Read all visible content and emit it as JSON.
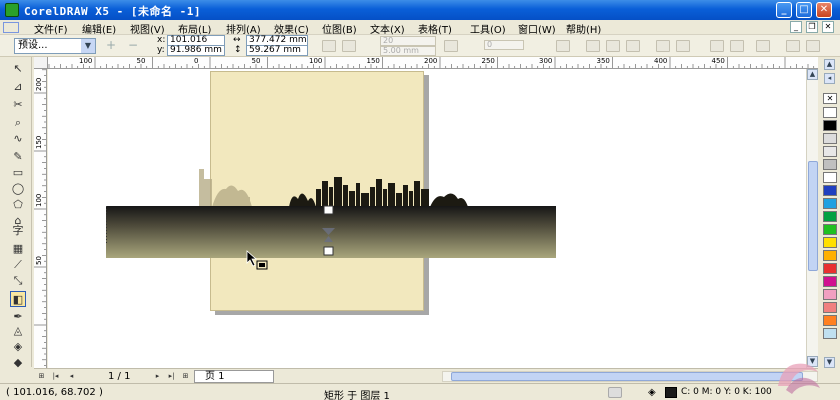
{
  "window": {
    "title": "CorelDRAW X5 - [未命名 -1]",
    "minimize_glyph": "_",
    "maximize_glyph": "□",
    "close_glyph": "✕"
  },
  "menu": {
    "items": [
      "文件(F)",
      "编辑(E)",
      "视图(V)",
      "布局(L)",
      "排列(A)",
      "效果(C)",
      "位图(B)",
      "文本(X)",
      "表格(T)",
      "工具(O)",
      "窗口(W)",
      "帮助(H)"
    ]
  },
  "propbar": {
    "preset_value": "预设...",
    "add_glyph": "+",
    "remove_glyph": "−",
    "x_label": "x:",
    "y_label": "y:",
    "x_value": "101.016 mm",
    "y_value": "91.986 mm",
    "w_value": "377.472 mm",
    "h_value": "59.267 mm",
    "steps_value": "20",
    "spacing_value": "5.00 mm",
    "angle_value": "0"
  },
  "toolbox": {
    "tools": [
      {
        "name": "pick-tool-icon",
        "glyph": "↖"
      },
      {
        "name": "shape-tool-icon",
        "glyph": "⊿"
      },
      {
        "name": "crop-tool-icon",
        "glyph": "✂"
      },
      {
        "name": "zoom-tool-icon",
        "glyph": "⌕"
      },
      {
        "name": "freehand-tool-icon",
        "glyph": "∿"
      },
      {
        "name": "smart-fill-tool-icon",
        "glyph": "✎"
      },
      {
        "name": "rectangle-tool-icon",
        "glyph": "▭"
      },
      {
        "name": "ellipse-tool-icon",
        "glyph": "◯"
      },
      {
        "name": "polygon-tool-icon",
        "glyph": "⬠"
      },
      {
        "name": "basic-shapes-tool-icon",
        "glyph": "⌂"
      },
      {
        "name": "text-tool-icon",
        "glyph": "字"
      },
      {
        "name": "table-tool-icon",
        "glyph": "▦"
      },
      {
        "name": "dimension-tool-icon",
        "glyph": "⟋"
      },
      {
        "name": "connector-tool-icon",
        "glyph": "⤡"
      },
      {
        "name": "interactive-blend-tool-icon",
        "glyph": "◧"
      },
      {
        "name": "eyedropper-tool-icon",
        "glyph": "✒"
      },
      {
        "name": "outline-tool-icon",
        "glyph": "◬"
      },
      {
        "name": "fill-tool-icon",
        "glyph": "◈"
      },
      {
        "name": "interactive-fill-tool-icon",
        "glyph": "◆"
      }
    ],
    "active_index": 14
  },
  "rulers": {
    "h_labels": [
      "100",
      "50",
      "0",
      "50",
      "100",
      "150",
      "200",
      "250",
      "300",
      "350",
      "400",
      "450"
    ],
    "v_labels": [
      "200",
      "150",
      "100",
      "50"
    ]
  },
  "palette": {
    "colors": [
      "#ffffff",
      "#000000",
      "#dcdcdc",
      "#e8e8e8",
      "#bfbfbf",
      "#ffffff",
      "#1f3fbf",
      "#1fa0e0",
      "#00a040",
      "#20c020",
      "#ffe000",
      "#ffb000",
      "#e83030",
      "#d01090",
      "#f0a0c0",
      "#f08080",
      "#ff8020",
      "#c0e0f0"
    ],
    "none_glyph": "✕"
  },
  "navbar": {
    "page_count": "1 / 1",
    "page_tab": "页 1"
  },
  "status": {
    "coords": "( 101.016, 68.702 )",
    "object_info": "矩形 于 图层 1",
    "fill_info": "C: 0 M: 0 Y: 0 K: 100"
  },
  "colors": {
    "title_blue": "#0a5fd8",
    "page_fill": "#f2e8be",
    "band_top": "#1a1a1a",
    "band_bottom": "#a7a57a"
  }
}
